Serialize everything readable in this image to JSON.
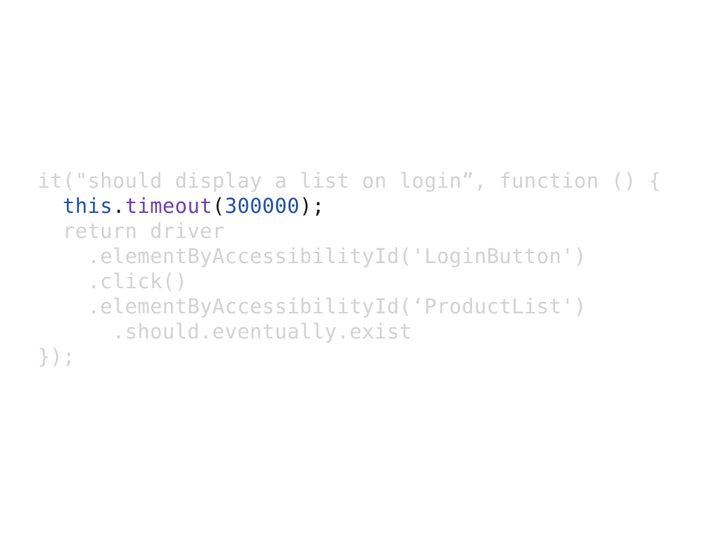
{
  "code": {
    "line1": "it(\"should display a list on login”, function () {",
    "line2": {
      "indent": "  ",
      "this_kw": "this",
      "dot": ".",
      "method": "timeout",
      "open_paren": "(",
      "number": "300000",
      "close": ");"
    },
    "line3": "  return driver",
    "line4": "    .elementByAccessibilityId('LoginButton')",
    "line5": "    .click()",
    "line6": "    .elementByAccessibilityId(‘ProductList')",
    "line7": "      .should.eventually.exist",
    "line8": "});"
  },
  "colors": {
    "dimmed_text": "#d2d2d2",
    "keyword_this": "#1f4fa5",
    "method_name": "#6a3fb0",
    "number_literal": "#1f4fa5",
    "punctuation": "#111111",
    "background": "#ffffff"
  }
}
